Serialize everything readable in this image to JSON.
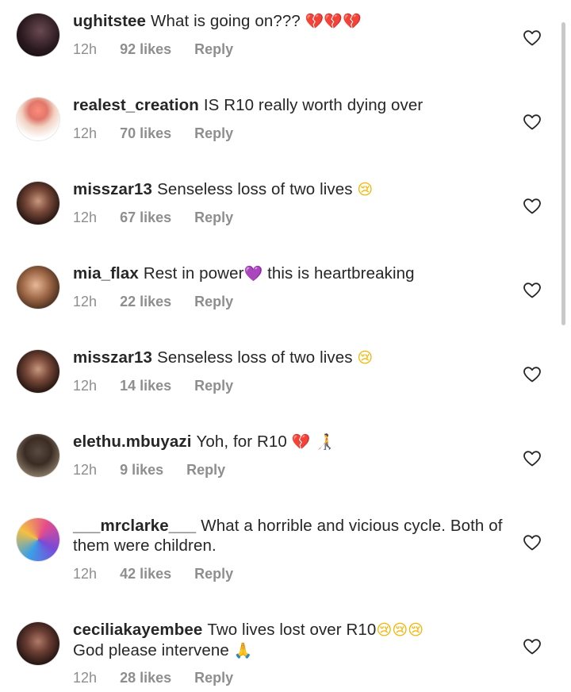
{
  "comments": [
    {
      "username": "ughitstee",
      "text": "What is going on???",
      "emoji": "💔💔💔",
      "emoji_color": "#d32f2f",
      "time": "12h",
      "likes": "92 likes",
      "reply": "Reply"
    },
    {
      "username": "realest_creation",
      "text": "IS R10 really worth dying over",
      "emoji": "",
      "time": "12h",
      "likes": "70 likes",
      "reply": "Reply"
    },
    {
      "username": "misszar13",
      "text": "Senseless loss of two lives",
      "emoji": "😢",
      "emoji_color": "#f4b400",
      "time": "12h",
      "likes": "67 likes",
      "reply": "Reply"
    },
    {
      "username": "mia_flax",
      "text": "Rest in power",
      "emoji": "💜",
      "emoji_color": "#9b3de0",
      "text_after": "this is heartbreaking",
      "time": "12h",
      "likes": "22 likes",
      "reply": "Reply"
    },
    {
      "username": "misszar13",
      "text": "Senseless loss of two lives",
      "emoji": "😢",
      "emoji_color": "#f4b400",
      "time": "12h",
      "likes": "14 likes",
      "reply": "Reply"
    },
    {
      "username": "elethu.mbuyazi",
      "text": "Yoh, for R10",
      "emoji": "💔 🧑‍🦯",
      "emoji_color": "#d32f2f",
      "time": "12h",
      "likes": "9 likes",
      "reply": "Reply"
    },
    {
      "username": "___mrclarke___",
      "text": "What a horrible and vicious cycle. Both of them were children.",
      "emoji": "",
      "time": "12h",
      "likes": "42 likes",
      "reply": "Reply"
    },
    {
      "username": "ceciliakayembee",
      "text": "Two lives lost over R10",
      "emoji": "😢😢😢",
      "emoji_color": "#f4b400",
      "text_after": "God please intervene",
      "emoji_after": "🙏",
      "time": "12h",
      "likes": "28 likes",
      "reply": "Reply"
    }
  ],
  "icons": {
    "like": "heart-outline-icon"
  },
  "colors": {
    "text": "#262626",
    "meta": "#8e8e8e",
    "heart_outline": "#262626"
  }
}
